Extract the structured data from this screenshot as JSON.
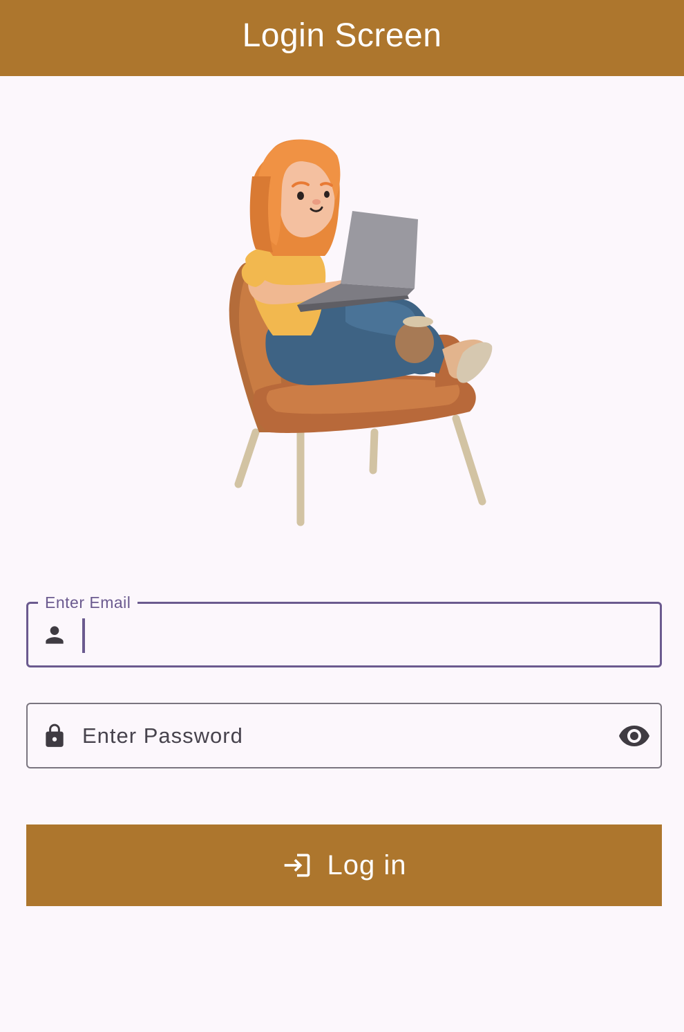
{
  "app_bar": {
    "title": "Login Screen"
  },
  "illustration": {
    "description_icon": "woman-with-laptop-in-armchair-illustration"
  },
  "email_field": {
    "label": "Enter Email",
    "value": "",
    "icon": "person-icon"
  },
  "password_field": {
    "placeholder": "Enter Password",
    "icon": "lock-icon",
    "toggle_icon": "eye-icon"
  },
  "login_button": {
    "label": "Log in",
    "icon": "login-icon"
  },
  "colors": {
    "primary": "#ad762d",
    "focus": "#6b5a8f",
    "background": "#fcf7fc"
  }
}
